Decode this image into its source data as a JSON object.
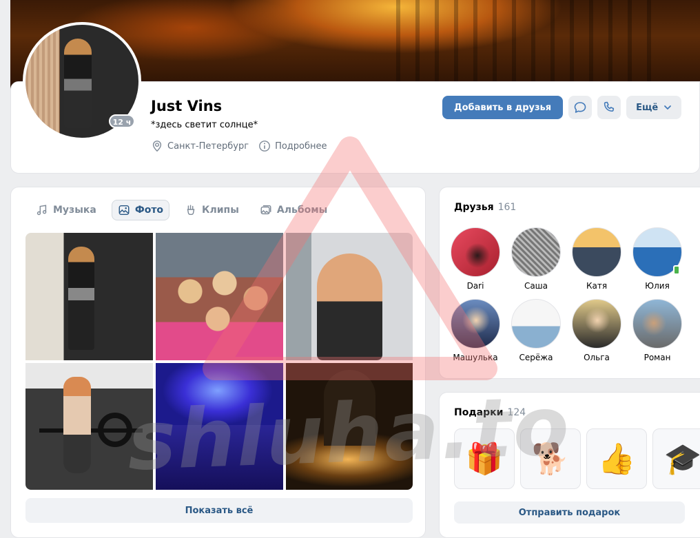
{
  "profile": {
    "name": "Just Vins",
    "status": "*здесь светит солнце*",
    "online_ago": "12 ч",
    "city": "Санкт-Петербург",
    "details_label": "Подробнее"
  },
  "actions": {
    "add_friend": "Добавить в друзья",
    "more": "Ещё"
  },
  "media_tabs": [
    {
      "label": "Музыка",
      "icon": "music-icon",
      "active": false
    },
    {
      "label": "Фото",
      "icon": "photo-icon",
      "active": true
    },
    {
      "label": "Клипы",
      "icon": "clips-icon",
      "active": false
    },
    {
      "label": "Альбомы",
      "icon": "albums-icon",
      "active": false
    }
  ],
  "photos": {
    "show_all": "Показать всё"
  },
  "friends": {
    "title": "Друзья",
    "count": "161",
    "items": [
      {
        "name": "Dari"
      },
      {
        "name": "Саша"
      },
      {
        "name": "Катя"
      },
      {
        "name": "Юлия"
      },
      {
        "name": "Машулька"
      },
      {
        "name": "Серёжа"
      },
      {
        "name": "Ольга"
      },
      {
        "name": "Роман"
      }
    ]
  },
  "gifts": {
    "title": "Подарки",
    "count": "124",
    "send_label": "Отправить подарок"
  },
  "watermark": "shluha.to",
  "colors": {
    "accent": "#447bba",
    "link": "#2a5885",
    "background": "#edeef0"
  }
}
